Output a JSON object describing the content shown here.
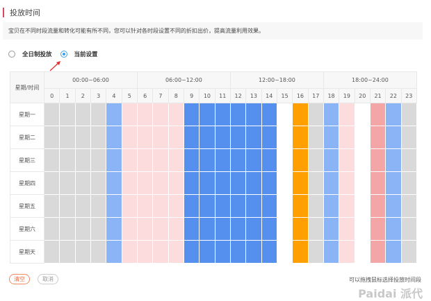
{
  "section_title": "投放时间",
  "tip": "宝贝在不同时段流量和转化可能有所不同，您可以针对各时段设置不同的折扣出价，提高流量利用效果。",
  "radios": [
    {
      "label": "全日制投放",
      "checked": false
    },
    {
      "label": "当前设置",
      "checked": true
    }
  ],
  "table": {
    "corner": "星期/时间",
    "groups": [
      "00:00~06:00",
      "06:00~12:00",
      "12:00~18:00",
      "18:00~24:00"
    ],
    "hours": [
      "0",
      "1",
      "2",
      "3",
      "4",
      "5",
      "6",
      "7",
      "8",
      "9",
      "10",
      "11",
      "12",
      "13",
      "14",
      "15",
      "16",
      "17",
      "18",
      "19",
      "20",
      "21",
      "22",
      "23"
    ],
    "days": [
      "星期一",
      "星期二",
      "星期三",
      "星期四",
      "星期五",
      "星期六",
      "星期天"
    ],
    "hour_levels": [
      "gray",
      "gray",
      "gray",
      "gray",
      "lightblue",
      "pink",
      "pink",
      "pink",
      "pink",
      "blue",
      "blue",
      "blue",
      "blue",
      "blue",
      "blue",
      "white",
      "orange",
      "gray",
      "lightblue",
      "pink",
      "white",
      "salmon",
      "lightblue",
      "gray"
    ],
    "level_colors": {
      "gray": "#d9d9d9",
      "lightblue": "#8ab4f5",
      "pink": "#fcdcdc",
      "blue": "#5590ee",
      "white": "#ffffff",
      "orange": "#ffa000",
      "salmon": "#f4a6a6"
    }
  },
  "buttons": {
    "clear": "清空",
    "cancel": "取消"
  },
  "hint": "可以拖拽鼠标选择投放时间段",
  "watermark": "Paidai 派代"
}
